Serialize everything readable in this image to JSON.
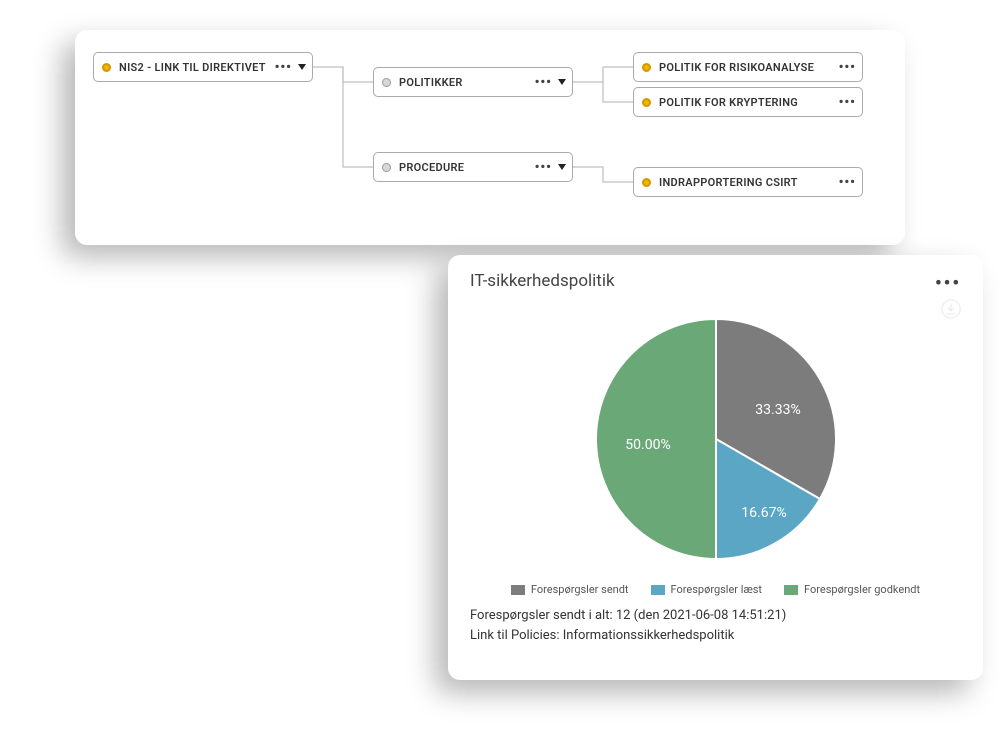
{
  "diagram": {
    "root": {
      "label": "NIS2 - LINK TIL DIREKTIVET",
      "dot": "y",
      "more": true,
      "caret": true
    },
    "mid1": {
      "label": "POLITIKKER",
      "dot": "g",
      "more": true,
      "caret": true
    },
    "mid2": {
      "label": "PROCEDURE",
      "dot": "g",
      "more": true,
      "caret": true
    },
    "leaf1": {
      "label": "POLITIK FOR RISIKOANALYSE",
      "dot": "y",
      "more": true,
      "caret": false
    },
    "leaf2": {
      "label": "POLITIK FOR KRYPTERING",
      "dot": "y",
      "more": true,
      "caret": false
    },
    "leaf3": {
      "label": "INDRAPPORTERING CSIRT",
      "dot": "y",
      "more": true,
      "caret": false
    }
  },
  "chart": {
    "title": "IT-sikkerhedspolitik",
    "meta1": "Forespørgsler sendt i alt: 12 (den 2021-06-08 14:51:21)",
    "meta2": "Link til Policies: Informationssikkerhedspolitik",
    "colors": {
      "sent": "#7c7c7c",
      "read": "#5aa6c4",
      "approved": "#6aa878"
    },
    "legend": {
      "sent": "Forespørgsler sendt",
      "read": "Forespørgsler læst",
      "approved": "Forespørgsler godkendt"
    },
    "slice_labels": {
      "sent": "33.33%",
      "read": "16.67%",
      "approved": "50.00%"
    }
  },
  "chart_data": {
    "type": "pie",
    "title": "IT-sikkerhedspolitik",
    "series": [
      {
        "name": "Forespørgsler sendt",
        "value": 33.33,
        "color": "#7c7c7c"
      },
      {
        "name": "Forespørgsler læst",
        "value": 16.67,
        "color": "#5aa6c4"
      },
      {
        "name": "Forespørgsler godkendt",
        "value": 50.0,
        "color": "#6aa878"
      }
    ],
    "total_requests": 12,
    "timestamp": "2021-06-08 14:51:21",
    "link_label": "Informationssikkerhedspolitik"
  }
}
